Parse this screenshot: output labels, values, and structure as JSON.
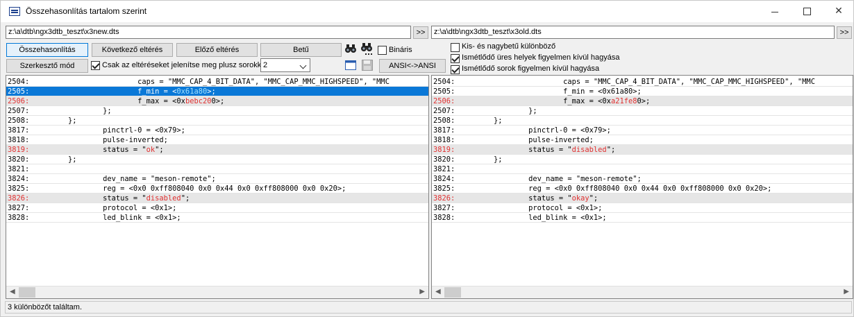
{
  "window": {
    "title": "Összehasonlítás tartalom szerint"
  },
  "left_path": "z:\\a\\dtb\\ngx3dtb_teszt\\x3new.dts",
  "right_path": "z:\\a\\dtb\\ngx3dtb_teszt\\x3old.dts",
  "browse_label": ">>",
  "buttons": {
    "compare": "Összehasonlítás",
    "next_diff": "Következő eltérés",
    "prev_diff": "Előző eltérés",
    "font": "Betű",
    "editor_mode": "Szerkesztő mód",
    "ansi": "ANSI<->ANSI"
  },
  "options": {
    "binary": "Bináris",
    "only_diffs": "Csak az eltéréseket jelenítse meg plusz sorokkal",
    "extra_lines": "2",
    "case_sensitive": "Kis- és nagybetű különböző",
    "ignore_spaces": "Ismétlődő üres helyek figyelmen kívül hagyása",
    "ignore_lines": "Ismétlődő sorok figyelmen kívül hagyása"
  },
  "left_lines": [
    {
      "n": "2504:",
      "t": "                    caps = \"MMC_CAP_4_BIT_DATA\", \"MMC_CAP_MMC_HIGHSPEED\", \"MMC",
      "state": "normal"
    },
    {
      "n": "2505:",
      "pre": "                    f_min = <",
      "hl": "0x61a80",
      "post": ">;",
      "state": "sel"
    },
    {
      "n": "2506:",
      "pre": "                    f_max = <0x",
      "hl": "bebc20",
      "post": "0>;",
      "state": "diff"
    },
    {
      "n": "2507:",
      "t": "            };",
      "state": "normal"
    },
    {
      "n": "2508:",
      "t": "    };",
      "state": "normal"
    },
    {
      "n": "3817:",
      "t": "            pinctrl-0 = <0x79>;",
      "state": "normal"
    },
    {
      "n": "3818:",
      "t": "            pulse-inverted;",
      "state": "normal"
    },
    {
      "n": "3819:",
      "pre": "            status = \"",
      "hl": "ok",
      "post": "\";",
      "state": "diff"
    },
    {
      "n": "3820:",
      "t": "    };",
      "state": "normal"
    },
    {
      "n": "3821:",
      "t": "",
      "state": "normal"
    },
    {
      "n": "3824:",
      "t": "            dev_name = \"meson-remote\";",
      "state": "normal"
    },
    {
      "n": "3825:",
      "t": "            reg = <0x0 0xff808040 0x0 0x44 0x0 0xff808000 0x0 0x20>;",
      "state": "normal"
    },
    {
      "n": "3826:",
      "pre": "            status = \"",
      "hl": "disabled",
      "post": "\";",
      "state": "diff"
    },
    {
      "n": "3827:",
      "t": "            protocol = <0x1>;",
      "state": "normal"
    },
    {
      "n": "3828:",
      "t": "            led_blink = <0x1>;",
      "state": "normal"
    }
  ],
  "right_lines": [
    {
      "n": "2504:",
      "t": "                    caps = \"MMC_CAP_4_BIT_DATA\", \"MMC_CAP_MMC_HIGHSPEED\", \"MMC",
      "state": "normal"
    },
    {
      "n": "2505:",
      "t": "                    f_min = <0x61a80>;",
      "state": "normal"
    },
    {
      "n": "2506:",
      "pre": "                    f_max = <0x",
      "hl": "a21fe8",
      "post": "0>;",
      "state": "diff"
    },
    {
      "n": "2507:",
      "t": "            };",
      "state": "normal"
    },
    {
      "n": "2508:",
      "t": "    };",
      "state": "normal"
    },
    {
      "n": "3817:",
      "t": "            pinctrl-0 = <0x79>;",
      "state": "normal"
    },
    {
      "n": "3818:",
      "t": "            pulse-inverted;",
      "state": "normal"
    },
    {
      "n": "3819:",
      "pre": "            status = \"",
      "hl": "disabled",
      "post": "\";",
      "state": "diff"
    },
    {
      "n": "3820:",
      "t": "    };",
      "state": "normal"
    },
    {
      "n": "3821:",
      "t": "",
      "state": "normal"
    },
    {
      "n": "3824:",
      "t": "            dev_name = \"meson-remote\";",
      "state": "normal"
    },
    {
      "n": "3825:",
      "t": "            reg = <0x0 0xff808040 0x0 0x44 0x0 0xff808000 0x0 0x20>;",
      "state": "normal"
    },
    {
      "n": "3826:",
      "pre": "            status = \"",
      "hl": "okay",
      "post": "\";",
      "state": "diff"
    },
    {
      "n": "3827:",
      "t": "            protocol = <0x1>;",
      "state": "normal"
    },
    {
      "n": "3828:",
      "t": "            led_blink = <0x1>;",
      "state": "normal"
    }
  ],
  "status_text": "3 különbözőt találtam."
}
